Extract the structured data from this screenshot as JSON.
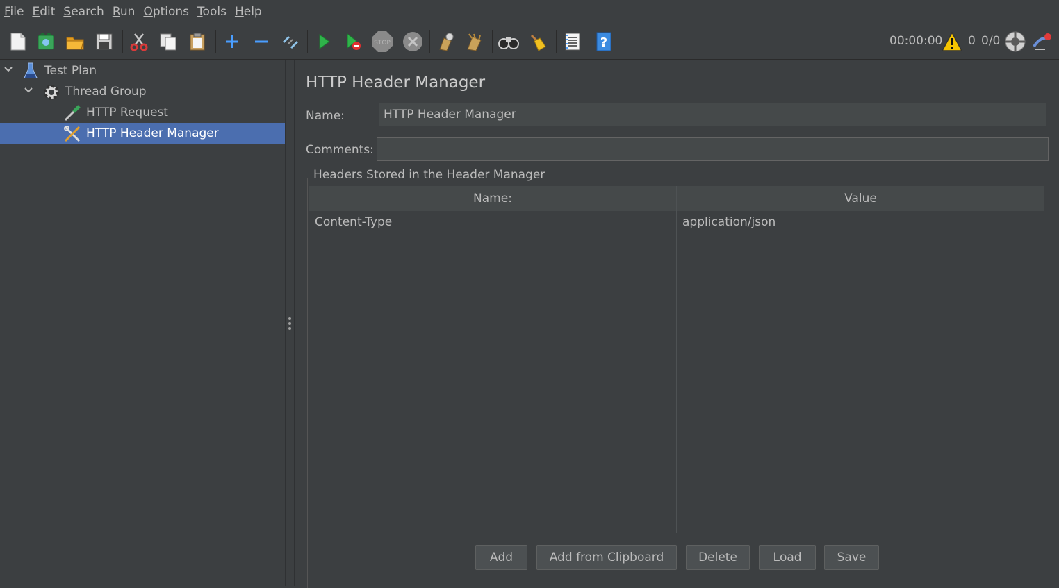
{
  "menu": [
    {
      "mnemonic": "F",
      "rest": "ile"
    },
    {
      "mnemonic": "E",
      "rest": "dit"
    },
    {
      "mnemonic": "S",
      "rest": "earch"
    },
    {
      "mnemonic": "R",
      "rest": "un"
    },
    {
      "mnemonic": "O",
      "rest": "ptions"
    },
    {
      "mnemonic": "T",
      "rest": "ools"
    },
    {
      "mnemonic": "H",
      "rest": "elp"
    }
  ],
  "toolbar": {
    "timer": "00:00:00",
    "warning_count": "0",
    "thread_ratio": "0/0",
    "stop_label": "STOP"
  },
  "tree": {
    "items": [
      {
        "label": "Test Plan",
        "icon": "flask-icon"
      },
      {
        "label": "Thread Group",
        "icon": "gear-icon"
      },
      {
        "label": "HTTP Request",
        "icon": "pipette-icon"
      },
      {
        "label": "HTTP Header Manager",
        "icon": "wrench-screwdriver-icon"
      }
    ]
  },
  "panel": {
    "title": "HTTP Header Manager",
    "name_label": "Name:",
    "name_value": "HTTP Header Manager",
    "comments_label": "Comments:",
    "comments_value": "",
    "group_title": "Headers Stored in the Header Manager",
    "table": {
      "columns": [
        "Name:",
        "Value"
      ],
      "rows": [
        {
          "name": "Content-Type",
          "value": "application/json"
        }
      ]
    }
  },
  "buttons": {
    "add": {
      "mnemonic": "A",
      "rest": "dd"
    },
    "add_clipboard": {
      "pre": "Add from ",
      "mnemonic": "C",
      "rest": "lipboard"
    },
    "delete": {
      "mnemonic": "D",
      "rest": "elete"
    },
    "load": {
      "mnemonic": "L",
      "rest": "oad"
    },
    "save": {
      "mnemonic": "S",
      "rest": "ave"
    }
  },
  "colors": {
    "background": "#3c3f41",
    "selection": "#4b6eaf",
    "field": "#45494a",
    "text": "#bbbbbb"
  }
}
